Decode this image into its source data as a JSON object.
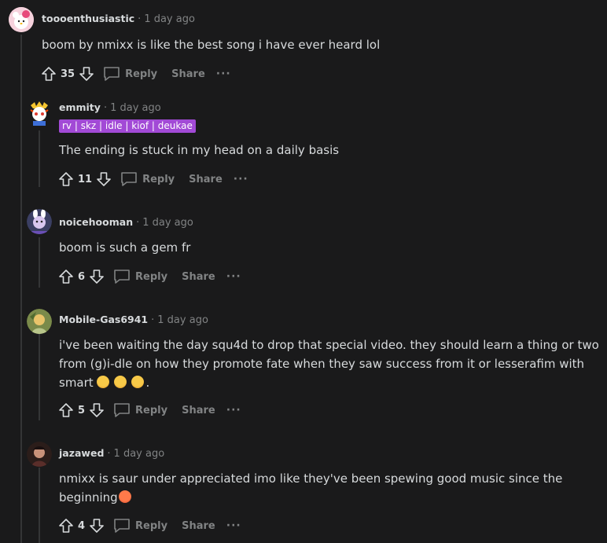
{
  "comments": [
    {
      "author": "toooenthusiastic",
      "time": "1 day ago",
      "text": "boom by nmixx is like the best song i have ever heard lol",
      "score": "35",
      "reply": "Reply",
      "share": "Share"
    },
    {
      "author": "emmity",
      "time": "1 day ago",
      "flair": "rv | skz | idle | kiof | deukae",
      "text": "The ending is stuck in my head on a daily basis",
      "score": "11",
      "reply": "Reply",
      "share": "Share"
    },
    {
      "author": "noicehooman",
      "time": "1 day ago",
      "text": "boom is such a gem fr",
      "score": "6",
      "reply": "Reply",
      "share": "Share"
    },
    {
      "author": "Mobile-Gas6941",
      "time": "1 day ago",
      "text_line1": "i've been waiting the day squ4d to drop that special video. they should learn a thing or two",
      "text_line2": "from (g)i-dle on how they promote fate when they saw success from it or lesserafim with",
      "text_line3": "smart",
      "text_end": ".",
      "score": "5",
      "reply": "Reply",
      "share": "Share"
    },
    {
      "author": "jazawed",
      "time": "1 day ago",
      "text_line1": "nmixx is saur under appreciated imo like they've been spewing good music since the",
      "text_line2": "beginning",
      "score": "4",
      "reply": "Reply",
      "share": "Share"
    }
  ],
  "dot": "·",
  "more": "···",
  "colors": {
    "background": "#1a1a1b",
    "flair": "#a24ad6",
    "muted": "#818384",
    "text": "#d7dadc"
  }
}
